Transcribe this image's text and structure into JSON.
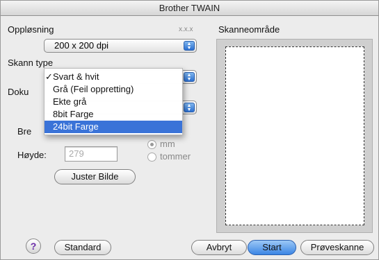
{
  "window": {
    "title": "Brother TWAIN"
  },
  "resolution": {
    "label": "Oppløsning",
    "units_hint": "x.x.x",
    "value": "200 x 200 dpi"
  },
  "scan_type": {
    "label": "Skann type",
    "menu_items": [
      "Svart & hvit",
      "Grå (Feil oppretting)",
      "Ekte grå",
      "8bit Farge",
      "24bit Farge"
    ],
    "checked_item": "Svart & hvit",
    "highlighted_item": "24bit Farge"
  },
  "document_size": {
    "label_partial": "Doku"
  },
  "dimensions": {
    "width_label_partial": "Bre",
    "height_label": "Høyde:",
    "height_value": "279",
    "unit_mm": "mm",
    "unit_inch": "tommer",
    "selected_unit": "mm"
  },
  "adjust_button": "Juster Bilde",
  "scan_area": {
    "label": "Skanneområde"
  },
  "footer": {
    "help_glyph": "?",
    "default_button": "Standard",
    "cancel_button": "Avbryt",
    "start_button": "Start",
    "preview_button": "Prøveskanne"
  },
  "icons": {
    "check": "check-icon",
    "popup_arrows": "popup-arrows-icon",
    "help": "help-icon"
  },
  "colors": {
    "highlight": "#3a73d8",
    "default_button": "#3b85e4"
  }
}
